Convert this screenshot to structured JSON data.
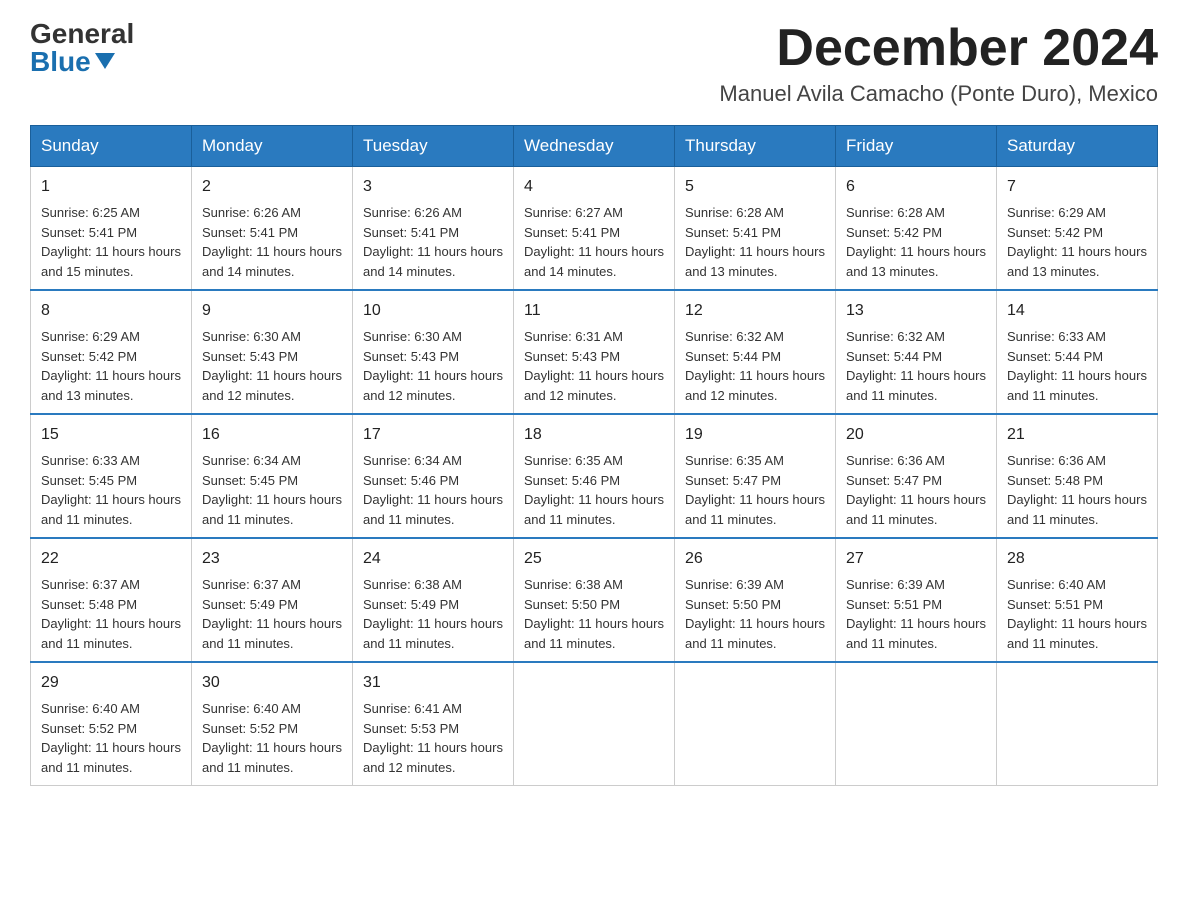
{
  "header": {
    "logo_general": "General",
    "logo_blue": "Blue",
    "month_title": "December 2024",
    "location": "Manuel Avila Camacho (Ponte Duro), Mexico"
  },
  "days_of_week": [
    "Sunday",
    "Monday",
    "Tuesday",
    "Wednesday",
    "Thursday",
    "Friday",
    "Saturday"
  ],
  "weeks": [
    [
      {
        "day": "1",
        "sunrise": "6:25 AM",
        "sunset": "5:41 PM",
        "daylight": "11 hours and 15 minutes."
      },
      {
        "day": "2",
        "sunrise": "6:26 AM",
        "sunset": "5:41 PM",
        "daylight": "11 hours and 14 minutes."
      },
      {
        "day": "3",
        "sunrise": "6:26 AM",
        "sunset": "5:41 PM",
        "daylight": "11 hours and 14 minutes."
      },
      {
        "day": "4",
        "sunrise": "6:27 AM",
        "sunset": "5:41 PM",
        "daylight": "11 hours and 14 minutes."
      },
      {
        "day": "5",
        "sunrise": "6:28 AM",
        "sunset": "5:41 PM",
        "daylight": "11 hours and 13 minutes."
      },
      {
        "day": "6",
        "sunrise": "6:28 AM",
        "sunset": "5:42 PM",
        "daylight": "11 hours and 13 minutes."
      },
      {
        "day": "7",
        "sunrise": "6:29 AM",
        "sunset": "5:42 PM",
        "daylight": "11 hours and 13 minutes."
      }
    ],
    [
      {
        "day": "8",
        "sunrise": "6:29 AM",
        "sunset": "5:42 PM",
        "daylight": "11 hours and 13 minutes."
      },
      {
        "day": "9",
        "sunrise": "6:30 AM",
        "sunset": "5:43 PM",
        "daylight": "11 hours and 12 minutes."
      },
      {
        "day": "10",
        "sunrise": "6:30 AM",
        "sunset": "5:43 PM",
        "daylight": "11 hours and 12 minutes."
      },
      {
        "day": "11",
        "sunrise": "6:31 AM",
        "sunset": "5:43 PM",
        "daylight": "11 hours and 12 minutes."
      },
      {
        "day": "12",
        "sunrise": "6:32 AM",
        "sunset": "5:44 PM",
        "daylight": "11 hours and 12 minutes."
      },
      {
        "day": "13",
        "sunrise": "6:32 AM",
        "sunset": "5:44 PM",
        "daylight": "11 hours and 11 minutes."
      },
      {
        "day": "14",
        "sunrise": "6:33 AM",
        "sunset": "5:44 PM",
        "daylight": "11 hours and 11 minutes."
      }
    ],
    [
      {
        "day": "15",
        "sunrise": "6:33 AM",
        "sunset": "5:45 PM",
        "daylight": "11 hours and 11 minutes."
      },
      {
        "day": "16",
        "sunrise": "6:34 AM",
        "sunset": "5:45 PM",
        "daylight": "11 hours and 11 minutes."
      },
      {
        "day": "17",
        "sunrise": "6:34 AM",
        "sunset": "5:46 PM",
        "daylight": "11 hours and 11 minutes."
      },
      {
        "day": "18",
        "sunrise": "6:35 AM",
        "sunset": "5:46 PM",
        "daylight": "11 hours and 11 minutes."
      },
      {
        "day": "19",
        "sunrise": "6:35 AM",
        "sunset": "5:47 PM",
        "daylight": "11 hours and 11 minutes."
      },
      {
        "day": "20",
        "sunrise": "6:36 AM",
        "sunset": "5:47 PM",
        "daylight": "11 hours and 11 minutes."
      },
      {
        "day": "21",
        "sunrise": "6:36 AM",
        "sunset": "5:48 PM",
        "daylight": "11 hours and 11 minutes."
      }
    ],
    [
      {
        "day": "22",
        "sunrise": "6:37 AM",
        "sunset": "5:48 PM",
        "daylight": "11 hours and 11 minutes."
      },
      {
        "day": "23",
        "sunrise": "6:37 AM",
        "sunset": "5:49 PM",
        "daylight": "11 hours and 11 minutes."
      },
      {
        "day": "24",
        "sunrise": "6:38 AM",
        "sunset": "5:49 PM",
        "daylight": "11 hours and 11 minutes."
      },
      {
        "day": "25",
        "sunrise": "6:38 AM",
        "sunset": "5:50 PM",
        "daylight": "11 hours and 11 minutes."
      },
      {
        "day": "26",
        "sunrise": "6:39 AM",
        "sunset": "5:50 PM",
        "daylight": "11 hours and 11 minutes."
      },
      {
        "day": "27",
        "sunrise": "6:39 AM",
        "sunset": "5:51 PM",
        "daylight": "11 hours and 11 minutes."
      },
      {
        "day": "28",
        "sunrise": "6:40 AM",
        "sunset": "5:51 PM",
        "daylight": "11 hours and 11 minutes."
      }
    ],
    [
      {
        "day": "29",
        "sunrise": "6:40 AM",
        "sunset": "5:52 PM",
        "daylight": "11 hours and 11 minutes."
      },
      {
        "day": "30",
        "sunrise": "6:40 AM",
        "sunset": "5:52 PM",
        "daylight": "11 hours and 11 minutes."
      },
      {
        "day": "31",
        "sunrise": "6:41 AM",
        "sunset": "5:53 PM",
        "daylight": "11 hours and 12 minutes."
      },
      null,
      null,
      null,
      null
    ]
  ],
  "labels": {
    "sunrise": "Sunrise:",
    "sunset": "Sunset:",
    "daylight": "Daylight:"
  }
}
